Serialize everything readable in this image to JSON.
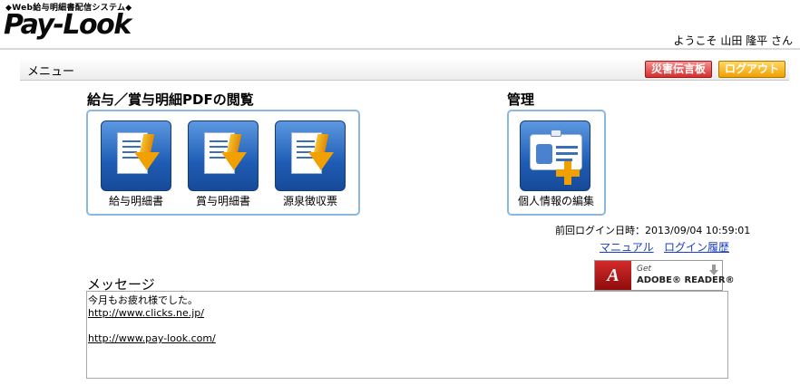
{
  "header": {
    "tagline": "◆Web給与明細書配信システム◆",
    "logo": "Pay-Look",
    "welcome": "ようこそ 山田 隆平 さん"
  },
  "menubar": {
    "label": "メニュー",
    "disaster_button": "災害伝言板",
    "logout_button": "ログアウト"
  },
  "pdf_section": {
    "title": "給与／賞与明細PDFの閲覧",
    "tiles": [
      {
        "label": "給与明細書",
        "icon": "document-download-icon"
      },
      {
        "label": "賞与明細書",
        "icon": "document-download-icon"
      },
      {
        "label": "源泉徴収票",
        "icon": "document-download-icon"
      }
    ]
  },
  "admin_section": {
    "title": "管理",
    "tiles": [
      {
        "label": "個人情報の編集",
        "icon": "id-card-plus-icon"
      }
    ]
  },
  "info": {
    "last_login": "前回ログイン日時：2013/09/04 10:59:01",
    "manual_link": "マニュアル",
    "login_history_link": "ログイン履歴"
  },
  "adobe": {
    "get": "Get",
    "name": "ADOBE® READER®"
  },
  "message": {
    "title": "メッセージ",
    "lines": [
      {
        "text": "今月もお疲れ様でした。",
        "is_link": false
      },
      {
        "text": "http://www.clicks.ne.jp/",
        "is_link": true
      },
      {
        "text": "",
        "is_link": false
      },
      {
        "text": "http://www.pay-look.com/",
        "is_link": true
      }
    ]
  },
  "colors": {
    "accent_blue": "#1f5cb5",
    "group_border": "#8ab8e0",
    "disaster_red": "#d62f2f",
    "logout_orange": "#f0a000",
    "link_blue": "#1a3fc8"
  }
}
